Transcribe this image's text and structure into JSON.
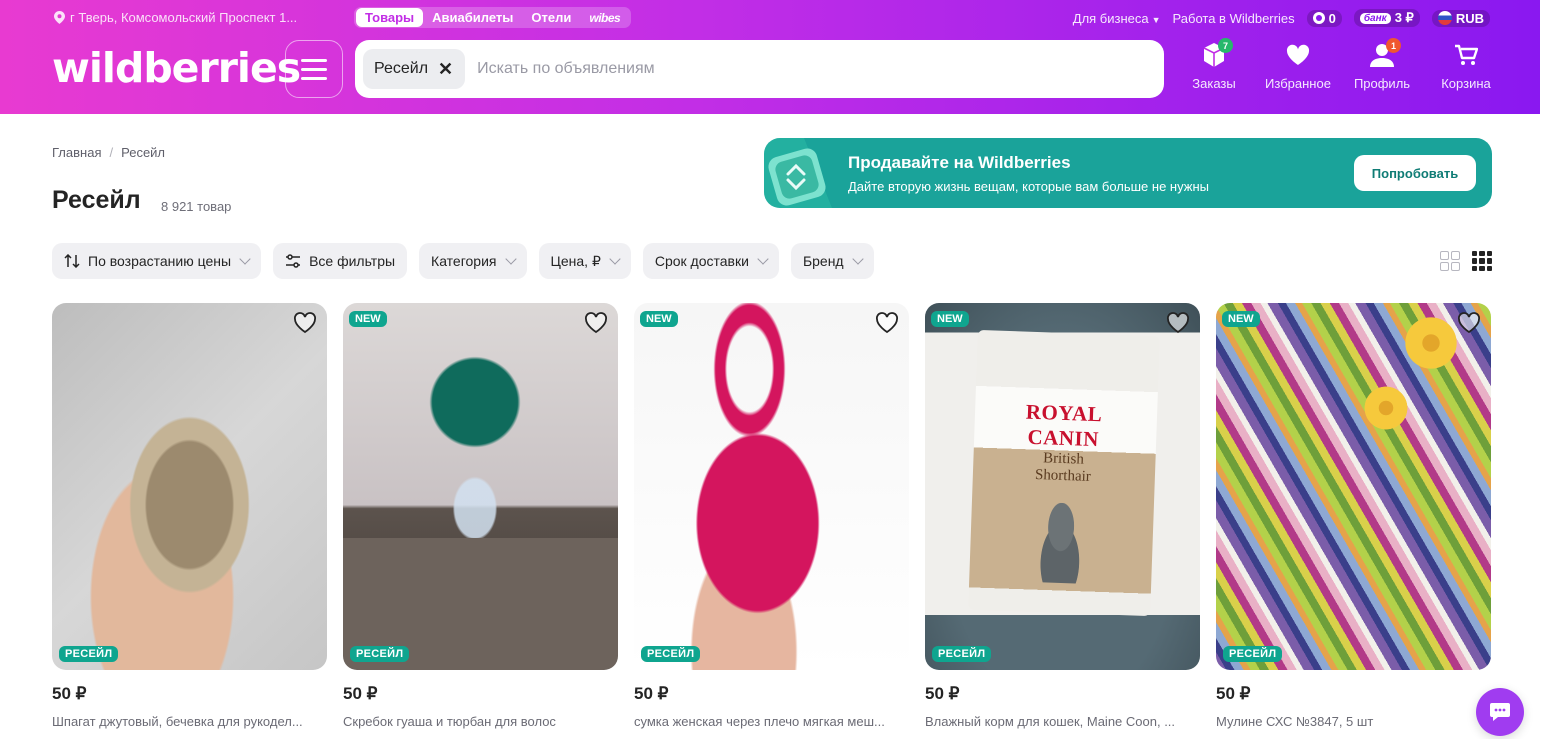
{
  "header": {
    "location": "г Тверь, Комсомольский Проспект 1...",
    "tabs": [
      "Товары",
      "Авиабилеты",
      "Отели",
      "wibes"
    ],
    "business": "Для бизнеса",
    "work": "Работа в Wildberries",
    "points": "0",
    "bank_label": "банк",
    "bank_balance": "3 ₽",
    "currency": "RUB",
    "logo": "wildberries",
    "search": {
      "chip": "Ресейл",
      "placeholder": "Искать по объявлениям"
    },
    "nav": [
      {
        "label": "Заказы",
        "badge": "7",
        "icon": "box-icon"
      },
      {
        "label": "Избранное",
        "badge": "",
        "icon": "heart-icon"
      },
      {
        "label": "Профиль",
        "badge": "1",
        "icon": "user-icon"
      },
      {
        "label": "Корзина",
        "badge": "",
        "icon": "cart-icon"
      }
    ]
  },
  "breadcrumb": [
    "Главная",
    "Ресейл"
  ],
  "page": {
    "title": "Ресейл",
    "count": "8 921 товар"
  },
  "promo": {
    "title": "Продавайте на Wildberries",
    "subtitle": "Дайте вторую жизнь вещам, которые вам больше не нужны",
    "button": "Попробовать"
  },
  "filters": [
    "По возрастанию цены",
    "Все фильтры",
    "Категория",
    "Цена, ₽",
    "Срок доставки",
    "Бренд"
  ],
  "product_badges": {
    "new": "NEW",
    "resale": "РЕСЕЙЛ"
  },
  "pack_text": {
    "brand": "ROYAL CANIN",
    "line": "British Shorthair"
  },
  "products": [
    {
      "price": "50 ₽",
      "name": "Шпагат джутовый, бечевка для рукодел...",
      "is_new": false
    },
    {
      "price": "50 ₽",
      "name": "Скребок гуаша и тюрбан для волос",
      "is_new": true
    },
    {
      "price": "50 ₽",
      "name": "сумка женская через плечо мягкая меш...",
      "is_new": true
    },
    {
      "price": "50 ₽",
      "name": "Влажный корм для кошек, Maine Coon, ...",
      "is_new": true
    },
    {
      "price": "50 ₽",
      "name": "Мулине СХС №3847, 5 шт",
      "is_new": true
    }
  ],
  "colors": {
    "brand_start": "#e83ad1",
    "brand_end": "#8a18f0",
    "promo": "#1aa39a",
    "resale_tag": "#0fa58f"
  }
}
